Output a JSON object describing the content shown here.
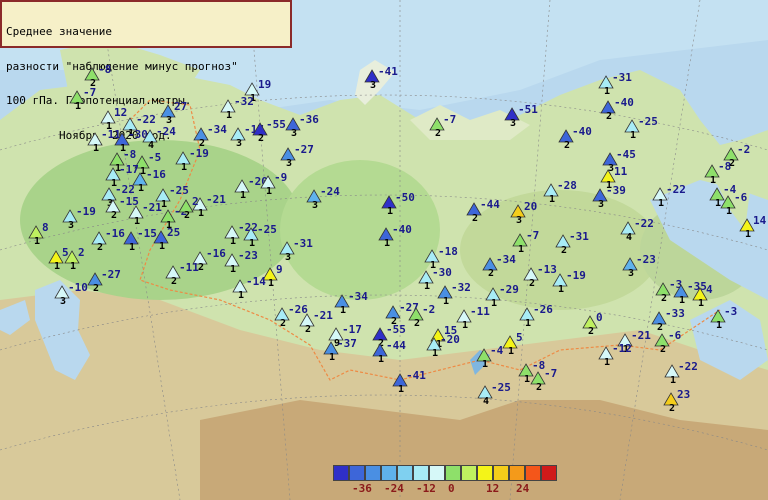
{
  "title": {
    "line1": "Среднее значение",
    "line2": "разности \"наблюдение минус прогноз\"",
    "line3": "100 гПа. Геопотенциал.метры.",
    "line4": "        Ноябрь  2020 год."
  },
  "legend": {
    "colors": [
      "#2f2fc8",
      "#3d66d9",
      "#4a8fe3",
      "#5fb2ec",
      "#7fd0f0",
      "#a8ecf6",
      "#d6f8f8",
      "#8ee06a",
      "#bff060",
      "#f4f418",
      "#f4cd1a",
      "#f49a1a",
      "#f4561a",
      "#d01a1a"
    ],
    "labels": [
      "-36",
      "-24",
      "-12",
      "0",
      "12",
      "24"
    ]
  },
  "stations": [
    {
      "v": "-8",
      "q": "2",
      "c": "#8ee06a"
    },
    {
      "v": "-7",
      "q": "1",
      "c": "#8ee06a"
    },
    {
      "v": "12",
      "q": "1",
      "c": "#d6f8f8"
    },
    {
      "v": "-22",
      "q": "1",
      "c": "#a8ecf6"
    },
    {
      "v": "27",
      "q": "3",
      "c": "#4a8fe3"
    },
    {
      "v": "19",
      "q": "1",
      "c": "#d6f8f8"
    },
    {
      "v": "-41",
      "q": "3",
      "c": "#2f2fc8"
    },
    {
      "v": "-11",
      "q": "1",
      "c": "#d6f8f8"
    },
    {
      "v": "-30",
      "q": "1",
      "c": "#3d66d9"
    },
    {
      "v": "-24",
      "q": "4",
      "c": "#a8ecf6"
    },
    {
      "v": "-32",
      "q": "1",
      "c": "#d6f8f8"
    },
    {
      "v": "-34",
      "q": "2",
      "c": "#4a8fe3"
    },
    {
      "v": "-17",
      "q": "3",
      "c": "#a8ecf6"
    },
    {
      "v": "-55",
      "q": "2",
      "c": "#2f2fc8"
    },
    {
      "v": "-36",
      "q": "3",
      "c": "#3d66d9"
    },
    {
      "v": "-7",
      "q": "2",
      "c": "#8ee06a"
    },
    {
      "v": "-51",
      "q": "3",
      "c": "#2f2fc8"
    },
    {
      "v": "-31",
      "q": "1",
      "c": "#a8ecf6"
    },
    {
      "v": "-40",
      "q": "2",
      "c": "#3d66d9"
    },
    {
      "v": "-8",
      "q": "1",
      "c": "#8ee06a"
    },
    {
      "v": "-5",
      "q": "1",
      "c": "#8ee06a"
    },
    {
      "v": "-19",
      "q": "1",
      "c": "#a8ecf6"
    },
    {
      "v": "-27",
      "q": "3",
      "c": "#4a8fe3"
    },
    {
      "v": "-40",
      "q": "2",
      "c": "#3d66d9"
    },
    {
      "v": "-25",
      "q": "1",
      "c": "#a8ecf6"
    },
    {
      "v": "-2",
      "q": "2",
      "c": "#8ee06a"
    },
    {
      "v": "-17",
      "q": "1",
      "c": "#a8ecf6"
    },
    {
      "v": "-16",
      "q": "1",
      "c": "#5fb2ec"
    },
    {
      "v": "-22",
      "q": "3",
      "c": "#a8ecf6"
    },
    {
      "v": "-25",
      "q": "1",
      "c": "#a8ecf6"
    },
    {
      "v": "-15",
      "q": "2",
      "c": "#d6f8f8"
    },
    {
      "v": "-45",
      "q": "3",
      "c": "#3d66d9"
    },
    {
      "v": "11",
      "q": "1",
      "c": "#f4f418"
    },
    {
      "v": "-8",
      "q": "1",
      "c": "#8ee06a"
    },
    {
      "v": "-4",
      "q": "1",
      "c": "#8ee06a"
    },
    {
      "v": "-20",
      "q": "1",
      "c": "#d6f8f8"
    },
    {
      "v": "-9",
      "q": "1",
      "c": "#d6f8f8"
    },
    {
      "v": "-28",
      "q": "1",
      "c": "#a8ecf6"
    },
    {
      "v": "-39",
      "q": "3",
      "c": "#3d66d9"
    },
    {
      "v": "-22",
      "q": "1",
      "c": "#d6f8f8"
    },
    {
      "v": "-6",
      "q": "1",
      "c": "#8ee06a"
    },
    {
      "v": "-21",
      "q": "1",
      "c": "#d6f8f8"
    },
    {
      "v": "-24",
      "q": "3",
      "c": "#5fb2ec"
    },
    {
      "v": "-50",
      "q": "1",
      "c": "#2f2fc8"
    },
    {
      "v": "-44",
      "q": "2",
      "c": "#3d66d9"
    },
    {
      "v": "20",
      "q": "3",
      "c": "#f4cd1a"
    },
    {
      "v": "-19",
      "q": "3",
      "c": "#a8ecf6"
    },
    {
      "v": "-21",
      "q": "1",
      "c": "#d6f8f8"
    },
    {
      "v": "-2",
      "q": "1",
      "c": "#8ee06a"
    },
    {
      "v": "2",
      "q": "2",
      "c": "#8ee06a"
    },
    {
      "v": "-22",
      "q": "4",
      "c": "#a8ecf6"
    },
    {
      "v": "14",
      "q": "1",
      "c": "#f4f418"
    },
    {
      "v": "8",
      "q": "1",
      "c": "#bff060"
    },
    {
      "v": "-16",
      "q": "2",
      "c": "#a8ecf6"
    },
    {
      "v": "-15",
      "q": "1",
      "c": "#3d66d9"
    },
    {
      "v": "25",
      "q": "1",
      "c": "#3d66d9"
    },
    {
      "v": "-22",
      "q": "1",
      "c": "#d6f8f8"
    },
    {
      "v": "-25",
      "q": "1",
      "c": "#a8ecf6"
    },
    {
      "v": "-40",
      "q": "1",
      "c": "#3d66d9"
    },
    {
      "v": "-7",
      "q": "1",
      "c": "#8ee06a"
    },
    {
      "v": "-31",
      "q": "2",
      "c": "#a8ecf6"
    },
    {
      "v": "5",
      "q": "1",
      "c": "#f4f418"
    },
    {
      "v": "2",
      "q": "1",
      "c": "#bff060"
    },
    {
      "v": "-16",
      "q": "2",
      "c": "#d6f8f8"
    },
    {
      "v": "-31",
      "q": "3",
      "c": "#a8ecf6"
    },
    {
      "v": "-18",
      "q": "1",
      "c": "#a8ecf6"
    },
    {
      "v": "-23",
      "q": "1",
      "c": "#d6f8f8"
    },
    {
      "v": "-34",
      "q": "2",
      "c": "#4a8fe3"
    },
    {
      "v": "-13",
      "q": "2",
      "c": "#d6f8f8"
    },
    {
      "v": "-19",
      "q": "1",
      "c": "#a8ecf6"
    },
    {
      "v": "-23",
      "q": "3",
      "c": "#5fb2ec"
    },
    {
      "v": "-27",
      "q": "2",
      "c": "#4a8fe3"
    },
    {
      "v": "-11",
      "q": "2",
      "c": "#d6f8f8"
    },
    {
      "v": "9",
      "q": "1",
      "c": "#f4f418"
    },
    {
      "v": "-14",
      "q": "1",
      "c": "#d6f8f8"
    },
    {
      "v": "-30",
      "q": "1",
      "c": "#a8ecf6"
    },
    {
      "v": "-3",
      "q": "2",
      "c": "#8ee06a"
    },
    {
      "v": "-35",
      "q": "1",
      "c": "#4a8fe3"
    },
    {
      "v": "-10",
      "q": "3",
      "c": "#d6f8f8"
    },
    {
      "v": "-32",
      "q": "1",
      "c": "#4a8fe3"
    },
    {
      "v": "-29",
      "q": "1",
      "c": "#a8ecf6"
    },
    {
      "v": "4",
      "q": "1",
      "c": "#f4f418"
    },
    {
      "v": "-34",
      "q": "1",
      "c": "#4a8fe3"
    },
    {
      "v": "-27",
      "q": "2",
      "c": "#4a8fe3"
    },
    {
      "v": "-2",
      "q": "2",
      "c": "#8ee06a"
    },
    {
      "v": "-26",
      "q": "1",
      "c": "#a8ecf6"
    },
    {
      "v": "-33",
      "q": "2",
      "c": "#4a8fe3"
    },
    {
      "v": "-3",
      "q": "1",
      "c": "#8ee06a"
    },
    {
      "v": "-26",
      "q": "2",
      "c": "#a8ecf6"
    },
    {
      "v": "-11",
      "q": "1",
      "c": "#d6f8f8"
    },
    {
      "v": "0",
      "q": "2",
      "c": "#bff060"
    },
    {
      "v": "-21",
      "q": "2",
      "c": "#d6f8f8"
    },
    {
      "v": "-17",
      "q": "9",
      "c": "#d6f8f8"
    },
    {
      "v": "-55",
      "q": "2",
      "c": "#2f2fc8"
    },
    {
      "v": "15",
      "q": "1",
      "c": "#f4f418"
    },
    {
      "v": "5",
      "q": "1",
      "c": "#f4f418"
    },
    {
      "v": "-21",
      "q": "1",
      "c": "#d6f8f8"
    },
    {
      "v": "-6",
      "q": "2",
      "c": "#8ee06a"
    },
    {
      "v": "-37",
      "q": "1",
      "c": "#4a8fe3"
    },
    {
      "v": "-44",
      "q": "1",
      "c": "#3d66d9"
    },
    {
      "v": "-20",
      "q": "1",
      "c": "#a8ecf6"
    },
    {
      "v": "-4",
      "q": "1",
      "c": "#8ee06a"
    },
    {
      "v": "-12",
      "q": "1",
      "c": "#d6f8f8"
    },
    {
      "v": "-8",
      "q": "1",
      "c": "#8ee06a"
    },
    {
      "v": "-7",
      "q": "2",
      "c": "#8ee06a"
    },
    {
      "v": "-22",
      "q": "1",
      "c": "#d6f8f8"
    },
    {
      "v": "-41",
      "q": "1",
      "c": "#3d66d9"
    },
    {
      "v": "-25",
      "q": "4",
      "c": "#a8ecf6"
    },
    {
      "v": "23",
      "q": "2",
      "c": "#f4cd1a"
    }
  ]
}
